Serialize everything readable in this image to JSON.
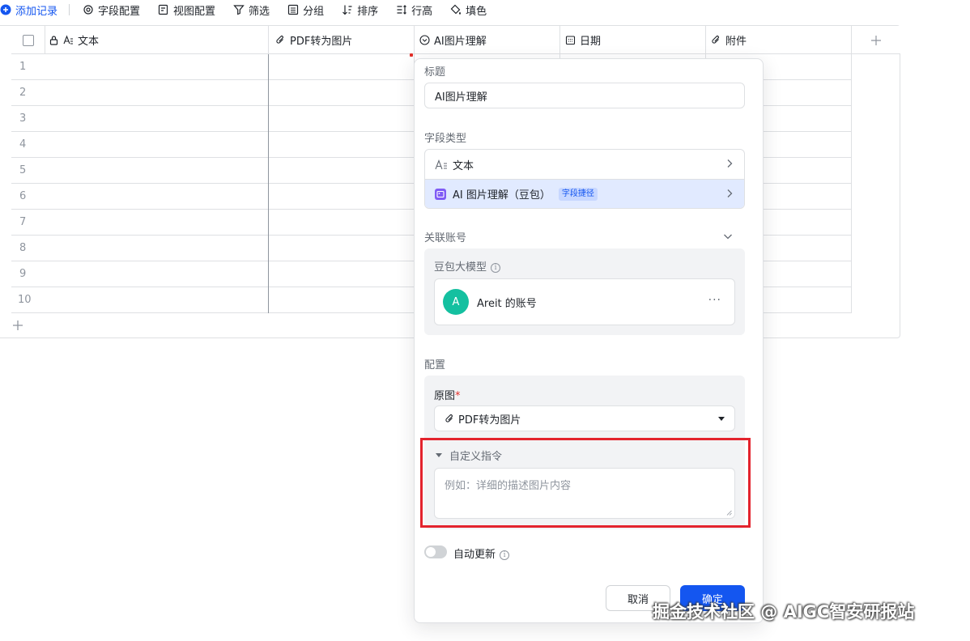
{
  "toolbar": {
    "add_record": "添加记录",
    "field_config": "字段配置",
    "view_config": "视图配置",
    "filter": "筛选",
    "group": "分组",
    "sort": "排序",
    "row_height": "行高",
    "fill": "填色"
  },
  "grid": {
    "columns": [
      "文本",
      "PDF转为图片",
      "AI图片理解",
      "日期",
      "附件"
    ],
    "rows": [
      "1",
      "2",
      "3",
      "4",
      "5",
      "6",
      "7",
      "8",
      "9",
      "10"
    ]
  },
  "panel": {
    "title_label": "标题",
    "title_value": "AI图片理解",
    "field_type_label": "字段类型",
    "type_text": "文本",
    "type_ai": "AI 图片理解（豆包）",
    "type_ai_badge": "字段捷径",
    "linked_account_label": "关联账号",
    "model_label": "豆包大模型",
    "account_avatar": "A",
    "account_name": "Areit 的账号",
    "account_more": "···",
    "config_label": "配置",
    "source_label": "原图",
    "source_required": "*",
    "source_value": "PDF转为图片",
    "custom_instruction_label": "自定义指令",
    "custom_instruction_placeholder": "例如：详细的描述图片内容",
    "auto_update_label": "自动更新",
    "auto_update_on": false,
    "cancel": "取消",
    "confirm": "确定"
  },
  "colors": {
    "accent": "#1456f0",
    "highlight": "#e3232d",
    "avatar": "#14c0a0"
  },
  "watermark": "掘金技术社区 @ AIGC智安研报站"
}
